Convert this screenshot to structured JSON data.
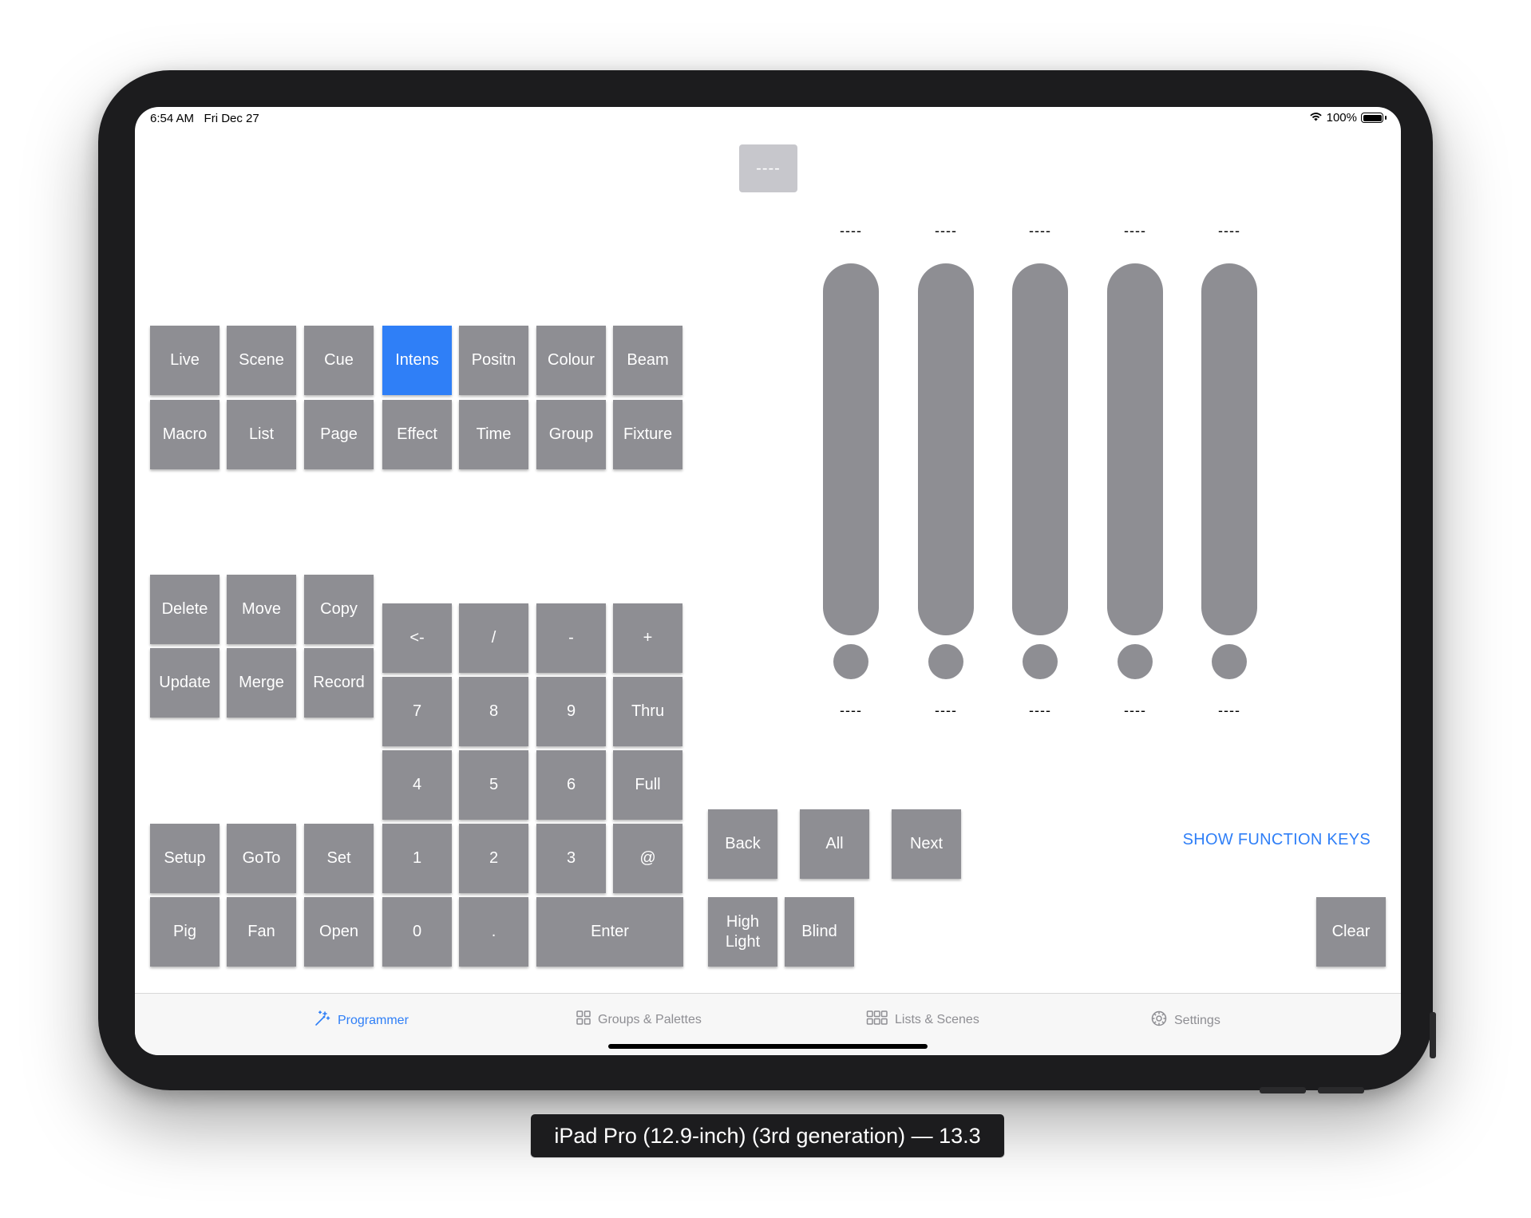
{
  "status_bar": {
    "time": "6:54 AM   Fri Dec 27",
    "battery": "100%"
  },
  "display": {
    "value": "----"
  },
  "mode_keys": {
    "live": "Live",
    "scene": "Scene",
    "cue": "Cue",
    "intens": "Intens",
    "positn": "Positn",
    "colour": "Colour",
    "beam": "Beam",
    "macro": "Macro",
    "list": "List",
    "page": "Page",
    "effect": "Effect",
    "time": "Time",
    "group": "Group",
    "fixture": "Fixture"
  },
  "edit_keys": {
    "delete": "Delete",
    "move": "Move",
    "copy": "Copy",
    "update": "Update",
    "merge": "Merge",
    "record": "Record"
  },
  "keypad": {
    "back": "<-",
    "slash": "/",
    "minus": "-",
    "plus": "+",
    "k7": "7",
    "k8": "8",
    "k9": "9",
    "thru": "Thru",
    "k4": "4",
    "k5": "5",
    "k6": "6",
    "full": "Full",
    "k1": "1",
    "k2": "2",
    "k3": "3",
    "at": "@",
    "k0": "0",
    "dot": ".",
    "enter": "Enter"
  },
  "func_keys": {
    "setup": "Setup",
    "goto": "GoTo",
    "set": "Set",
    "pig": "Pig",
    "fan": "Fan",
    "open": "Open"
  },
  "nav_keys": {
    "back": "Back",
    "all": "All",
    "next": "Next",
    "highlight": "High\nLight",
    "blind": "Blind",
    "clear": "Clear"
  },
  "faders": [
    {
      "top": "----",
      "bottom": "----"
    },
    {
      "top": "----",
      "bottom": "----"
    },
    {
      "top": "----",
      "bottom": "----"
    },
    {
      "top": "----",
      "bottom": "----"
    },
    {
      "top": "----",
      "bottom": "----"
    }
  ],
  "show_function_keys": "SHOW FUNCTION KEYS",
  "tabs": [
    {
      "label": "Programmer",
      "icon": "magic-wand-icon"
    },
    {
      "label": "Groups & Palettes",
      "icon": "grid-2x2-icon"
    },
    {
      "label": "Lists & Scenes",
      "icon": "grid-3x2-icon"
    },
    {
      "label": "Settings",
      "icon": "gear-icon"
    }
  ],
  "device_caption": "iPad Pro (12.9-inch) (3rd generation) — 13.3",
  "colors": {
    "key_gray": "#8e8e93",
    "accent_blue": "#2f7ff7",
    "display_gray": "#c7c7cc"
  }
}
